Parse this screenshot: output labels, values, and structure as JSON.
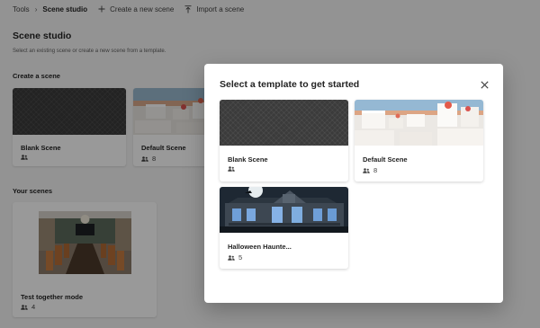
{
  "breadcrumb": {
    "root": "Tools",
    "separator": "›",
    "current": "Scene studio"
  },
  "actions": {
    "create_label": "Create a new scene",
    "import_label": "Import a scene"
  },
  "page": {
    "title": "Scene studio",
    "subtitle": "Select an existing scene or create a new scene from a template."
  },
  "create_section": {
    "heading": "Create a scene",
    "cards": [
      {
        "title": "Blank Scene",
        "count": ""
      },
      {
        "title": "Default Scene",
        "count": "8"
      }
    ]
  },
  "your_scenes": {
    "heading": "Your scenes",
    "cards": [
      {
        "title": "Test together mode",
        "count": "4"
      }
    ]
  },
  "dialog": {
    "title": "Select a template to get started",
    "templates": [
      {
        "name": "Blank Scene",
        "count": ""
      },
      {
        "name": "Default Scene",
        "count": "8"
      },
      {
        "name": "Halloween Haunte...",
        "count": "5"
      }
    ]
  },
  "icons": {
    "close": "close-icon",
    "people": "people-icon",
    "plus": "plus-icon",
    "import": "import-icon"
  },
  "colors": {
    "overlay": "#00000066",
    "blank_thumb": "#3b3b3b",
    "night_sky": "#1e2833"
  }
}
